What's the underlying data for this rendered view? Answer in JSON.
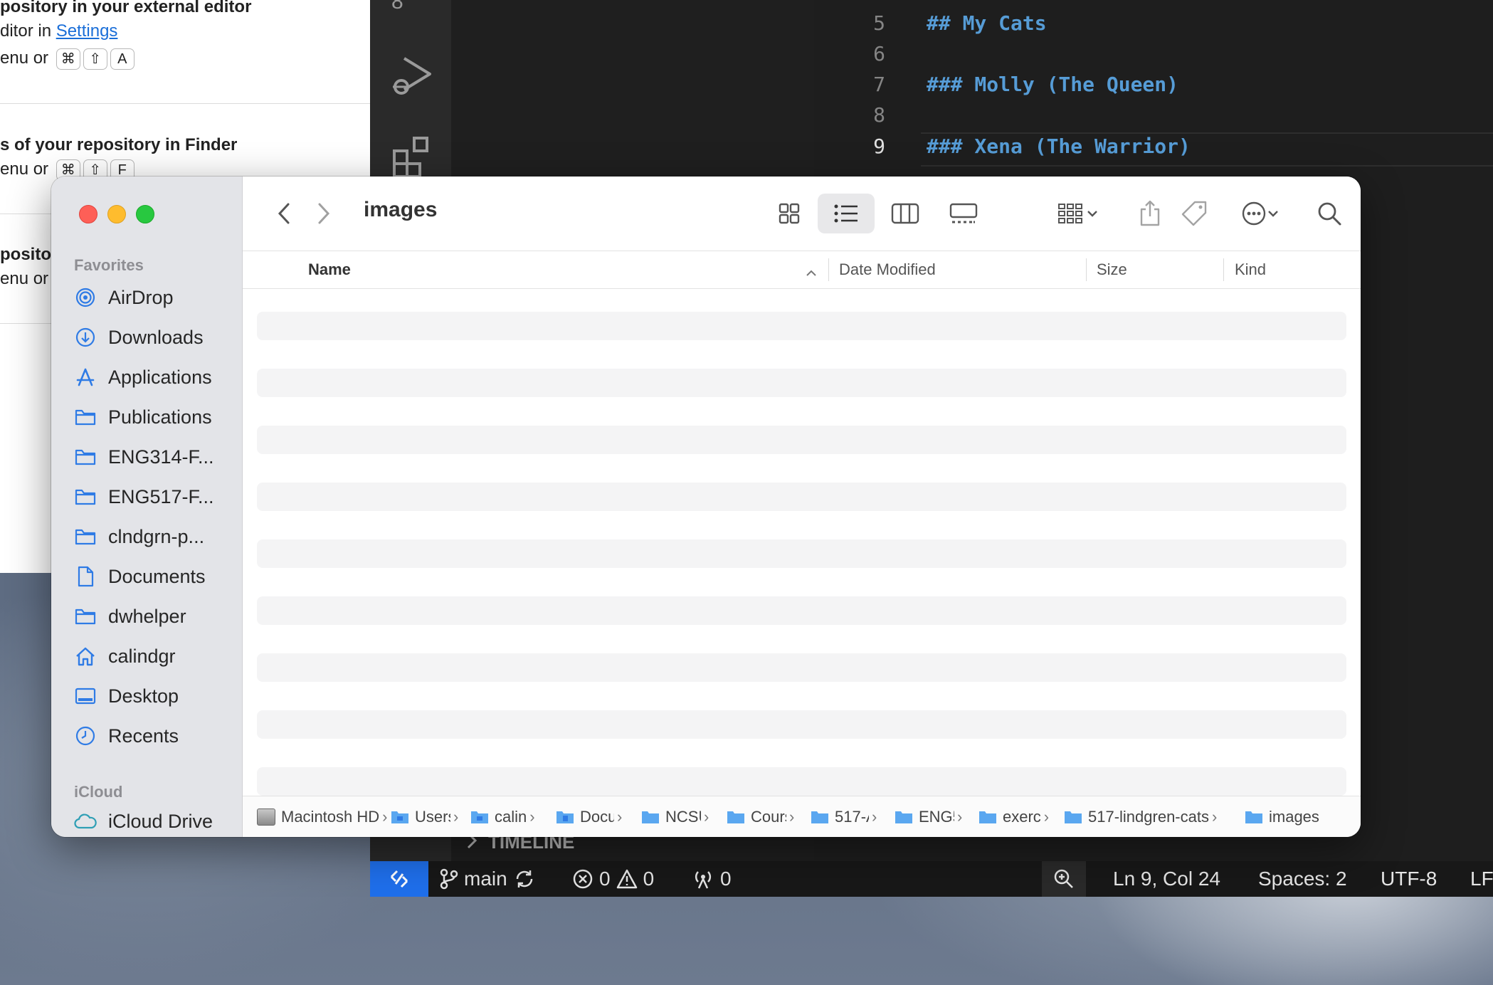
{
  "github_desktop": {
    "block1_title": "pository in your external editor",
    "block1_sub_prefix": "ditor in ",
    "block1_link": "Settings",
    "block1_shortcut_prefix": "enu or",
    "block1_keys": [
      "⌘",
      "⇧",
      "A"
    ],
    "block2_title": "s of your repository in Finder",
    "block2_shortcut_prefix": "enu or",
    "block2_keys": [
      "⌘",
      "⇧",
      "F"
    ],
    "block3_title": "posito",
    "block3_shortcut_prefix": "enu or"
  },
  "vscode": {
    "top_left_number": "8",
    "lines": [
      {
        "num": "5",
        "text": "## My Cats"
      },
      {
        "num": "6",
        "text": ""
      },
      {
        "num": "7",
        "text": "### Molly (The Queen)"
      },
      {
        "num": "8",
        "text": ""
      },
      {
        "num": "9",
        "text": "### Xena (The Warrior)"
      }
    ],
    "timeline_label": "TIMELINE",
    "status": {
      "branch": "main",
      "errors": "0",
      "warnings": "0",
      "ports": "0",
      "cursor": "Ln 9, Col 24",
      "spaces": "Spaces: 2",
      "encoding": "UTF-8",
      "eol": "LF"
    }
  },
  "finder": {
    "title": "images",
    "sidebar": {
      "favorites_header": "Favorites",
      "items": [
        {
          "label": "AirDrop",
          "icon": "airdrop-icon"
        },
        {
          "label": "Downloads",
          "icon": "downloads-icon"
        },
        {
          "label": "Applications",
          "icon": "applications-icon"
        },
        {
          "label": "Publications",
          "icon": "folder-icon"
        },
        {
          "label": "ENG314-F...",
          "icon": "folder-icon"
        },
        {
          "label": "ENG517-F...",
          "icon": "folder-icon"
        },
        {
          "label": "clndgrn-p...",
          "icon": "folder-icon"
        },
        {
          "label": "Documents",
          "icon": "document-icon"
        },
        {
          "label": "dwhelper",
          "icon": "folder-icon"
        },
        {
          "label": "calindgr",
          "icon": "home-icon"
        },
        {
          "label": "Desktop",
          "icon": "desktop-icon"
        },
        {
          "label": "Recents",
          "icon": "clock-icon"
        }
      ],
      "icloud_header": "iCloud",
      "icloud_items": [
        {
          "label": "iCloud Drive",
          "icon": "cloud-icon"
        }
      ]
    },
    "columns": {
      "name": "Name",
      "date": "Date Modified",
      "size": "Size",
      "kind": "Kind"
    },
    "path": [
      "Macintosh HD",
      "Users",
      "calin",
      "Docu",
      "NCSU",
      "Cours",
      "517-A",
      "ENG5",
      "exerc",
      "517-lindgren-cats",
      "images"
    ],
    "accent_color": "#2f7be5"
  }
}
